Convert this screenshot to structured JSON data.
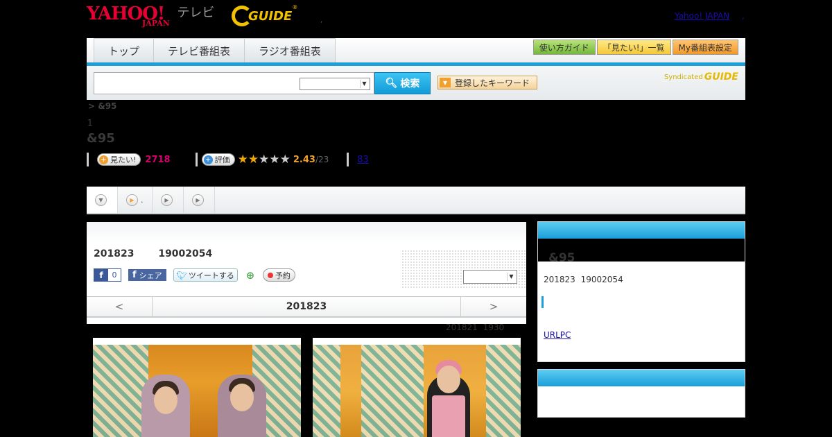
{
  "header": {
    "yahoo_logo": "YAHOO!",
    "yahoo_sub": "JAPAN",
    "tv_label": "テレビ",
    "gguide_logo": "GUIDE",
    "gguide_mark": "®",
    "separator": ",",
    "yahoo_japan_link": "Yahoo! JAPAN",
    "link_separator": ","
  },
  "nav": {
    "tabs": [
      "トップ",
      "テレビ番組表",
      "ラジオ番組表"
    ],
    "buttons": [
      "使い方ガイド",
      "「見たい!」一覧",
      "My番組表設定"
    ]
  },
  "search": {
    "input_value": "",
    "select_value": "",
    "button_label": "検索",
    "keyword_button": "登録したキーワード",
    "syndicated_label": "Syndicated",
    "syndicated_logo": "GUIDE"
  },
  "program": {
    "breadcrumb": "> &95",
    "episode_marker": "1",
    "title": "&95",
    "want_label": "見たい!",
    "want_count": "2718",
    "rate_label": "評価",
    "stars_filled": 2,
    "stars_total": 5,
    "rating_value": "2.43",
    "rating_count": "/23",
    "review_count": "83"
  },
  "tabs": [
    {
      "label": ""
    },
    {
      "label": "."
    },
    {
      "label": ""
    },
    {
      "label": ""
    }
  ],
  "main": {
    "airtime": "201823 19002054",
    "fb_count": "0",
    "fb_share": "シェア",
    "tweet": "ツイートする",
    "reserve": "予約",
    "select_value": "",
    "prev": "<",
    "date": "201823",
    "next": ">",
    "updated": "201821 1930"
  },
  "sidebar": {
    "title": "&95",
    "airtime": "201823 19002054",
    "url_link": "URLPC"
  }
}
